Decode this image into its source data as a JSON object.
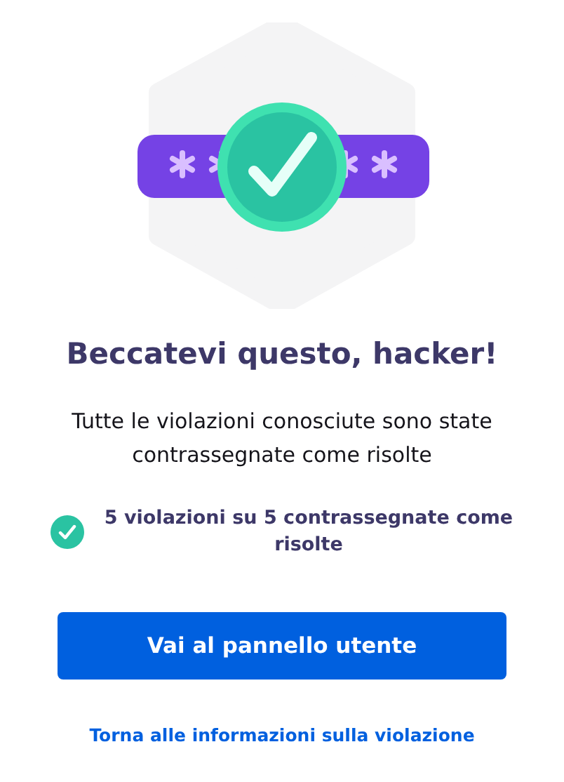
{
  "heading": "Beccatevi questo, hacker!",
  "message": "Tutte le violazioni conosciute sono state contrassegnate come risolte",
  "status": {
    "text": "5 violazioni su 5 contrassegnate come risolte",
    "done": true
  },
  "button": "Vai al pannello utente",
  "link": "Torna alle informazioni sulla violazione"
}
